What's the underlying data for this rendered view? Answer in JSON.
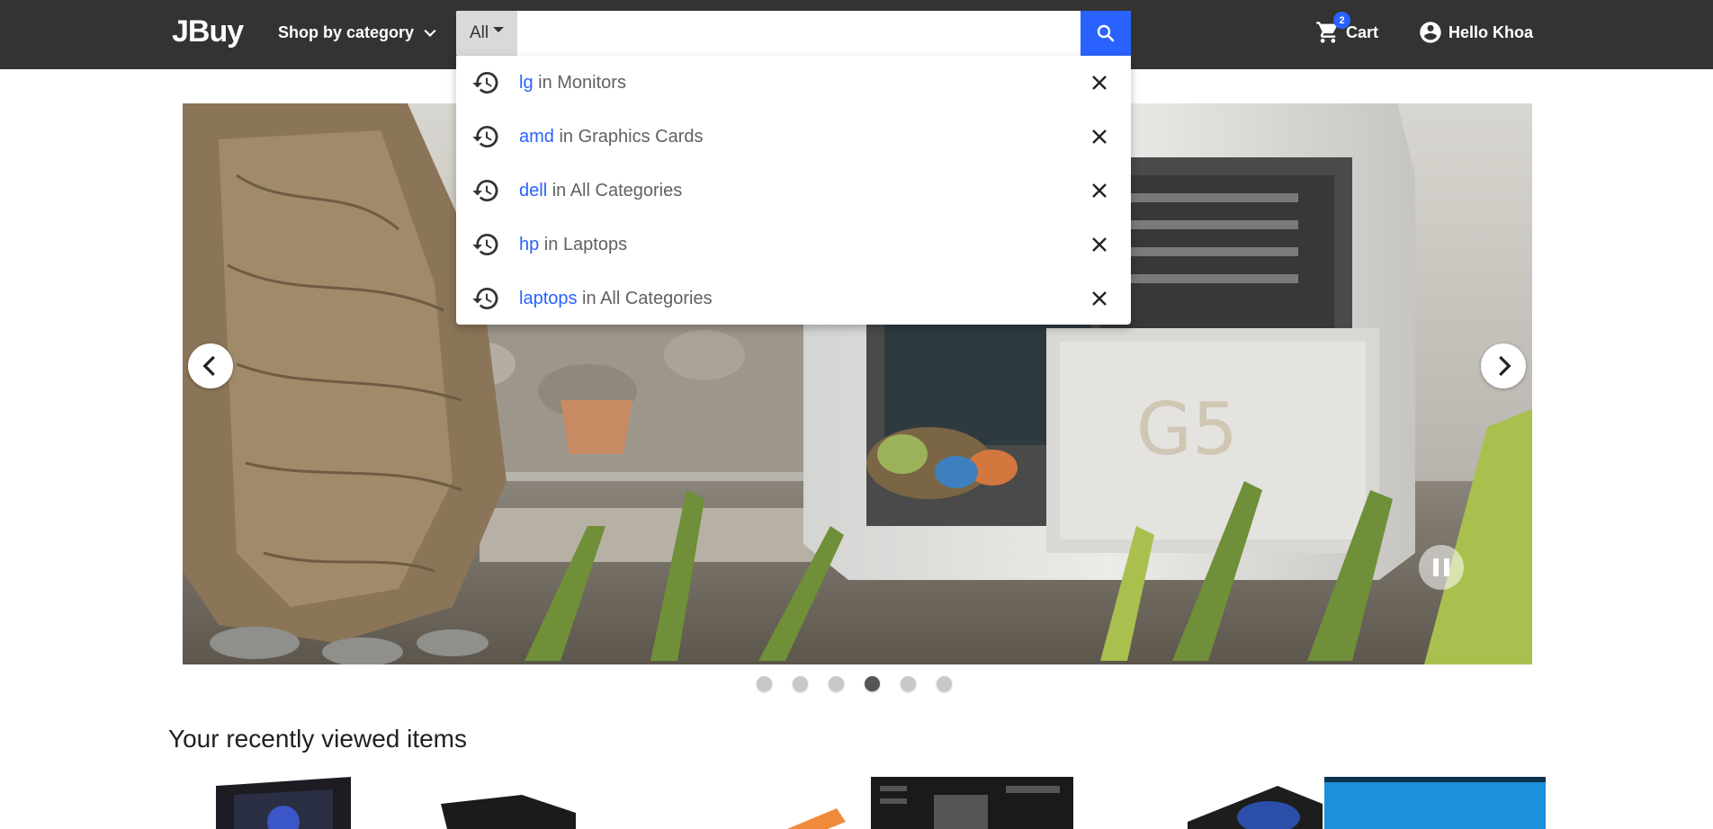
{
  "header": {
    "logo": "JBuy",
    "shop_by_category": "Shop by category",
    "search": {
      "category_label": "All",
      "query": "",
      "placeholder": ""
    },
    "cart": {
      "label": "Cart",
      "count": "2"
    },
    "account": {
      "label": "Hello Khoa"
    }
  },
  "search_suggestions": [
    {
      "term": "lg",
      "connector": " in ",
      "category": "Monitors"
    },
    {
      "term": "amd",
      "connector": " in ",
      "category": "Graphics Cards"
    },
    {
      "term": "dell",
      "connector": " in ",
      "category": "All Categories"
    },
    {
      "term": "hp",
      "connector": " in ",
      "category": "Laptops"
    },
    {
      "term": "laptops",
      "connector": " in ",
      "category": "All Categories"
    }
  ],
  "carousel": {
    "slide_count": 6,
    "active_index": 3,
    "slide_text": "G5"
  },
  "recently_viewed": {
    "title": "Your recently viewed items"
  },
  "colors": {
    "navbar": "#333333",
    "accent": "#2962ff",
    "suggestion_text": "#616161"
  },
  "icons": [
    "chevron-down-icon",
    "search-icon",
    "cart-icon",
    "account-circle-icon",
    "history-icon",
    "close-icon",
    "chevron-left-icon",
    "chevron-right-icon",
    "pause-icon"
  ]
}
